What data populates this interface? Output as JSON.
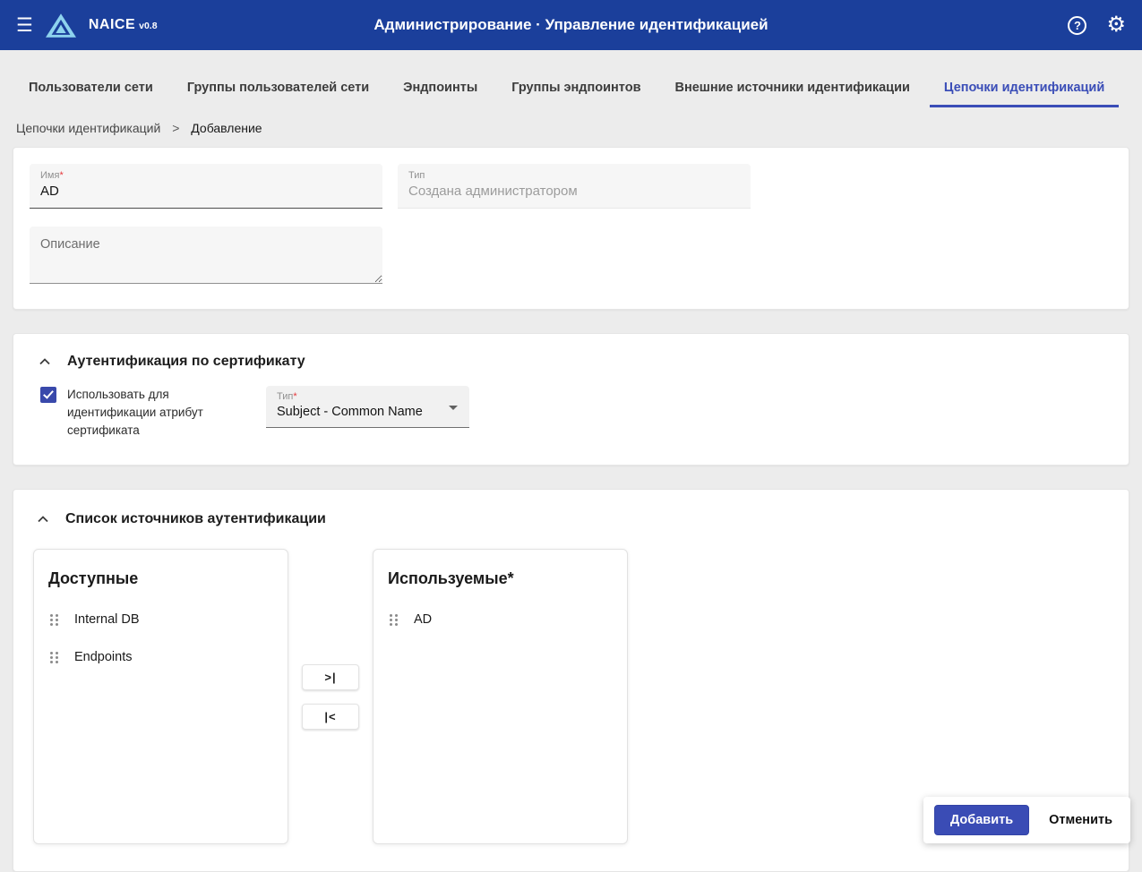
{
  "topbar": {
    "app_name": "NAICE",
    "app_version": "v0.8",
    "title": "Администрирование · Управление идентификацией"
  },
  "icons": {
    "menu": "☰",
    "help": "?",
    "gear": "⚙"
  },
  "tabs": [
    {
      "label": "Пользователи сети",
      "active": false
    },
    {
      "label": "Группы пользователей сети",
      "active": false
    },
    {
      "label": "Эндпоинты",
      "active": false
    },
    {
      "label": "Группы эндпоинтов",
      "active": false
    },
    {
      "label": "Внешние источники идентификации",
      "active": false
    },
    {
      "label": "Цепочки идентификаций",
      "active": true
    }
  ],
  "breadcrumb": {
    "parent": "Цепочки идентификаций",
    "separator": ">",
    "current": "Добавление"
  },
  "form": {
    "name_label": "Имя",
    "required_mark": "*",
    "name_value": "AD",
    "type_label": "Тип",
    "type_placeholder": "Создана администратором",
    "description_placeholder": "Описание"
  },
  "cert_section": {
    "title": "Аутентификация по сертификату",
    "checkbox_checked": true,
    "checkbox_label": "Использовать для идентификации атрибут сертификата",
    "select_label": "Тип",
    "required_mark": "*",
    "select_value": "Subject - Common Name"
  },
  "sources_section": {
    "title": "Список источников аутентификации",
    "available_title": "Доступные",
    "available_items": [
      {
        "label": "Internal DB"
      },
      {
        "label": "Endpoints"
      }
    ],
    "used_title": "Используемые*",
    "used_items": [
      {
        "label": "AD"
      }
    ],
    "move_all_right": ">|",
    "move_all_left": "|<"
  },
  "footer": {
    "submit_label": "Добавить",
    "cancel_label": "Отменить"
  },
  "colors": {
    "topbar": "#1b3f9b",
    "accent": "#3a4cb5",
    "required": "#e5393c"
  }
}
